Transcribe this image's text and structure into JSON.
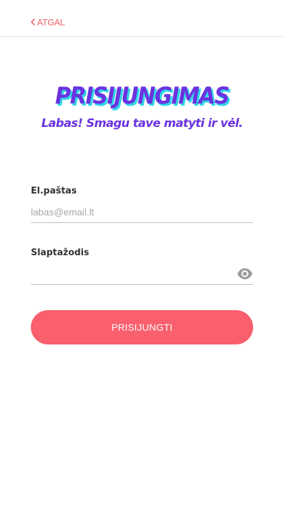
{
  "header": {
    "back_label": "ATGAL",
    "back_icon": "chevron-left-icon"
  },
  "hero": {
    "title": "PRISIJUNGIMAS",
    "subtitle": "Labas! Smagu tave matyti ir vėl."
  },
  "form": {
    "email": {
      "label": "El.paštas",
      "placeholder": "labas@email.lt",
      "value": ""
    },
    "password": {
      "label": "Slaptažodis",
      "placeholder": "",
      "value": "",
      "toggle_icon": "eye-icon"
    },
    "submit_label": "PRISIJUNGTI"
  },
  "colors": {
    "accent": "#f95f6d",
    "title": "#6b33e0",
    "title_shadow": "#2fd6e8"
  }
}
